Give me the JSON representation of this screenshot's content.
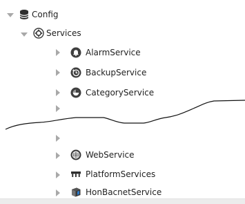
{
  "tree": {
    "config": {
      "label": "Config",
      "icon": "database-icon",
      "expanded": true
    },
    "services": {
      "label": "Services",
      "icon": "gear-icon",
      "expanded": true
    },
    "items_top": [
      {
        "label": "AlarmService",
        "icon": "bell-icon"
      },
      {
        "label": "BackupService",
        "icon": "history-clock-icon"
      },
      {
        "label": "CategoryService",
        "icon": "category-icon"
      }
    ],
    "items_bottom": [
      {
        "label": "WebService",
        "icon": "globe-icon"
      },
      {
        "label": "PlatformServices",
        "icon": "platform-icon"
      },
      {
        "label": "HonBacnetService",
        "icon": "bacnet-icon"
      }
    ]
  },
  "colors": {
    "icon_dark": "#4a4a4a",
    "twisty": "#a9a9a9",
    "tear_line": "#111111"
  }
}
